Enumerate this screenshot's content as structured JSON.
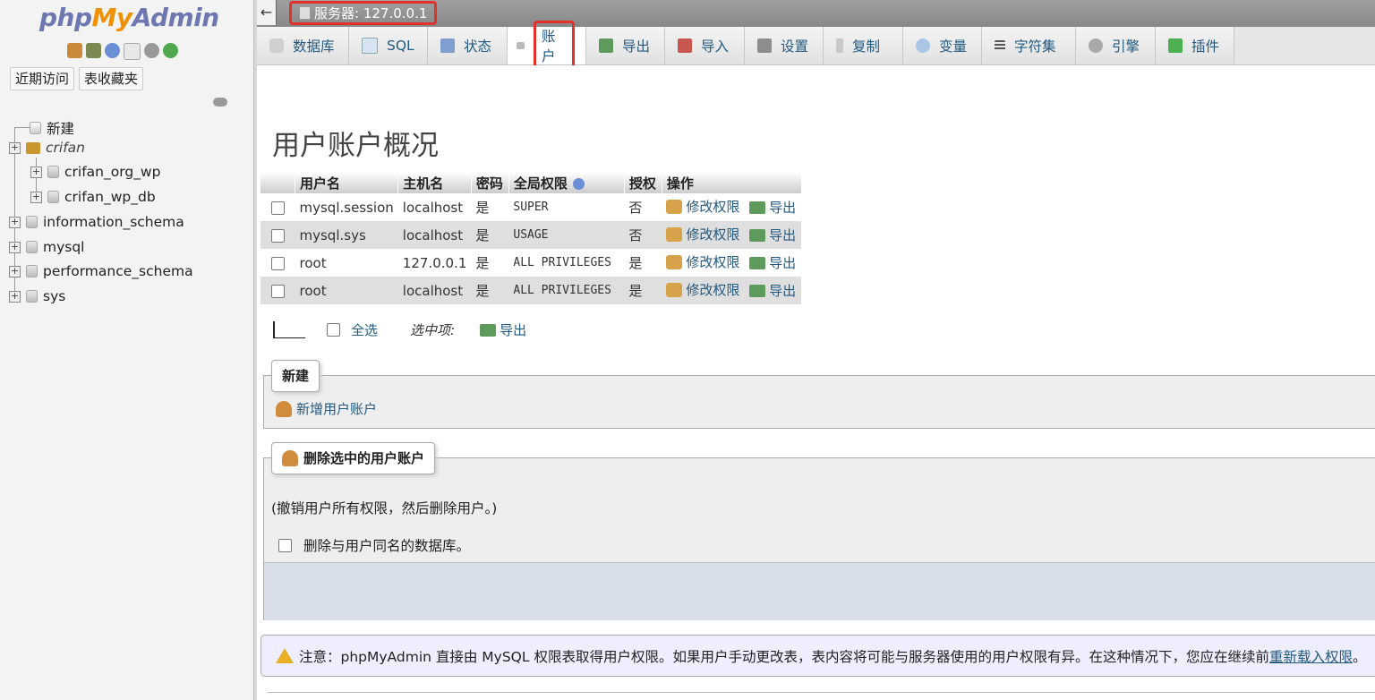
{
  "sidebar": {
    "logo": {
      "php": "php",
      "my": "My",
      "admin": "Admin"
    },
    "quick_icons": [
      "home-icon",
      "database-server-icon",
      "help-icon",
      "docs-icon",
      "settings-icon",
      "reload-icon"
    ],
    "nav_buttons": [
      "近期访问",
      "表收藏夹"
    ],
    "tree": [
      {
        "label": "新建",
        "icon": "new-db-icon"
      },
      {
        "label": "crifan",
        "icon": "folder-icon"
      },
      {
        "label": "crifan_org_wp",
        "icon": "db-icon"
      },
      {
        "label": "crifan_wp_db",
        "icon": "db-icon"
      },
      {
        "label": "information_schema",
        "icon": "db-icon"
      },
      {
        "label": "mysql",
        "icon": "db-icon"
      },
      {
        "label": "performance_schema",
        "icon": "db-icon"
      },
      {
        "label": "sys",
        "icon": "db-icon"
      }
    ]
  },
  "topbar": {
    "back_symbol": "←",
    "server_label": "服务器: 127.0.0.1"
  },
  "tabs": [
    {
      "label": "数据库",
      "icon": "database-icon"
    },
    {
      "label": "SQL",
      "icon": "sql-icon"
    },
    {
      "label": "状态",
      "icon": "status-icon"
    },
    {
      "label": "账户",
      "icon": "accounts-icon",
      "active": true
    },
    {
      "label": "导出",
      "icon": "export-icon"
    },
    {
      "label": "导入",
      "icon": "import-icon"
    },
    {
      "label": "设置",
      "icon": "wrench-icon"
    },
    {
      "label": "复制",
      "icon": "replication-icon"
    },
    {
      "label": "变量",
      "icon": "variables-icon"
    },
    {
      "label": "字符集",
      "icon": "charset-icon"
    },
    {
      "label": "引擎",
      "icon": "engine-icon"
    },
    {
      "label": "插件",
      "icon": "plugin-icon"
    }
  ],
  "main": {
    "title": "用户账户概况",
    "table": {
      "headers": [
        "用户名",
        "主机名",
        "密码",
        "全局权限",
        "授权",
        "操作"
      ],
      "rows": [
        {
          "user": "mysql.session",
          "host": "localhost",
          "password": "是",
          "privileges": "SUPER",
          "grant": "否",
          "edit": "修改权限",
          "export": "导出"
        },
        {
          "user": "mysql.sys",
          "host": "localhost",
          "password": "是",
          "privileges": "USAGE",
          "grant": "否",
          "edit": "修改权限",
          "export": "导出"
        },
        {
          "user": "root",
          "host": "127.0.0.1",
          "password": "是",
          "privileges": "ALL PRIVILEGES",
          "grant": "是",
          "edit": "修改权限",
          "export": "导出"
        },
        {
          "user": "root",
          "host": "localhost",
          "password": "是",
          "privileges": "ALL PRIVILEGES",
          "grant": "是",
          "edit": "修改权限",
          "export": "导出"
        }
      ]
    },
    "select_all": "全选",
    "with_selected": "选中项:",
    "bulk_export": "导出",
    "new_section": {
      "legend": "新建",
      "add_user": "新增用户账户"
    },
    "delete_section": {
      "legend": "删除选中的用户账户",
      "note": "(撤销用户所有权限，然后删除用户。)",
      "drop_db_label": "删除与用户同名的数据库。"
    },
    "notice": {
      "text": "注意：phpMyAdmin 直接由 MySQL 权限表取得用户权限。如果用户手动更改表，表内容将可能与服务器使用的用户权限有异。在这种情况下，您应在继续前",
      "link": "重新载入权限",
      "end": "。"
    }
  }
}
